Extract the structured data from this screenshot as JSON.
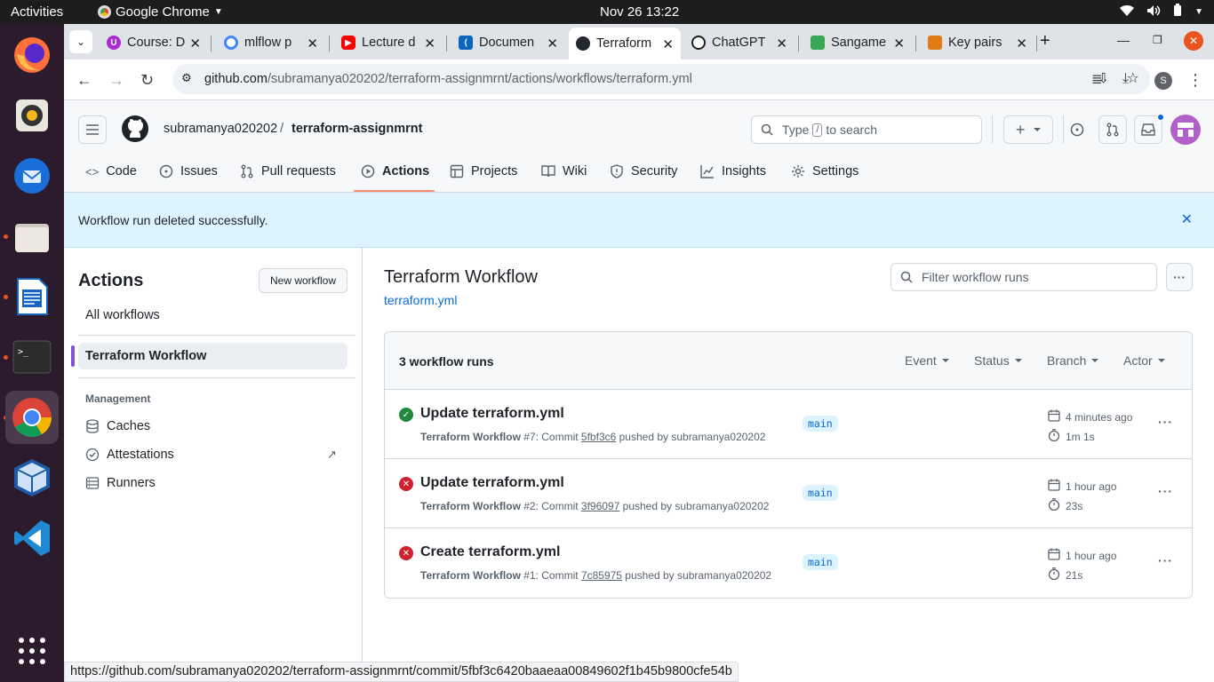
{
  "system": {
    "activities": "Activities",
    "app_name": "Google Chrome",
    "clock": "Nov 26  13:22"
  },
  "tabs": [
    {
      "title": "Course: D",
      "icon": "course-icon",
      "color": "#a82bd6"
    },
    {
      "title": "mlflow p",
      "icon": "google-icon",
      "color": "#4285f4"
    },
    {
      "title": "Lecture d",
      "icon": "youtube-icon",
      "color": "#ff0000"
    },
    {
      "title": "Documen",
      "icon": "vscode-icon",
      "color": "#0a66c2"
    },
    {
      "title": "Terraform",
      "icon": "github-icon",
      "color": "#24292f"
    },
    {
      "title": "ChatGPT",
      "icon": "chatgpt-icon",
      "color": "#1f1f1f"
    },
    {
      "title": "Sangame",
      "icon": "sangam-icon",
      "color": "#3aa757"
    },
    {
      "title": "Key pairs",
      "icon": "aws-icon",
      "color": "#e07b15"
    }
  ],
  "omnibox": {
    "domain": "github.com",
    "path": "/subramanya020202/terraform-assignmrnt/actions/workflows/terraform.yml"
  },
  "profile_letter": "S",
  "github": {
    "owner": "subramanya020202",
    "slash": "/",
    "repo": "terraform-assignmrnt",
    "search_type": "Type",
    "search_key": "/",
    "search_suffix": "to search",
    "plus": "+"
  },
  "repo_nav": [
    "Code",
    "Issues",
    "Pull requests",
    "Actions",
    "Projects",
    "Wiki",
    "Security",
    "Insights",
    "Settings"
  ],
  "flash": "Workflow run deleted successfully.",
  "sidebar": {
    "title": "Actions",
    "new_workflow": "New workflow",
    "all_workflows": "All workflows",
    "selected_workflow": "Terraform Workflow",
    "management": "Management",
    "links": [
      "Caches",
      "Attestations",
      "Runners"
    ]
  },
  "main": {
    "title": "Terraform Workflow",
    "file": "terraform.yml",
    "filter_placeholder": "Filter workflow runs",
    "count": "3 workflow runs",
    "filters": [
      "Event",
      "Status",
      "Branch",
      "Actor"
    ]
  },
  "runs": [
    {
      "name": "Update terraform.yml",
      "status": "success",
      "workflow": "Terraform Workflow",
      "detail": " #7: Commit ",
      "commit": "5fbf3c6",
      "pushed": " pushed by subramanya020202",
      "branch": "main",
      "time": "4 minutes ago",
      "duration": "1m 1s"
    },
    {
      "name": "Update terraform.yml",
      "status": "failure",
      "workflow": "Terraform Workflow",
      "detail": " #2: Commit ",
      "commit": "3f96097",
      "pushed": " pushed by subramanya020202",
      "branch": "main",
      "time": "1 hour ago",
      "duration": "23s"
    },
    {
      "name": "Create terraform.yml",
      "status": "failure",
      "workflow": "Terraform Workflow",
      "detail": " #1: Commit ",
      "commit": "7c85975",
      "pushed": " pushed by subramanya020202",
      "branch": "main",
      "time": "1 hour ago",
      "duration": "21s"
    }
  ],
  "status_url": "https://github.com/subramanya020202/terraform-assignmrnt/commit/5fbf3c6420baaeaa00849602f1b45b9800cfe54b",
  "colors": {
    "success": "#1f883d",
    "failure": "#cf222e",
    "accent": "#fd8c73",
    "link": "#0969da"
  }
}
